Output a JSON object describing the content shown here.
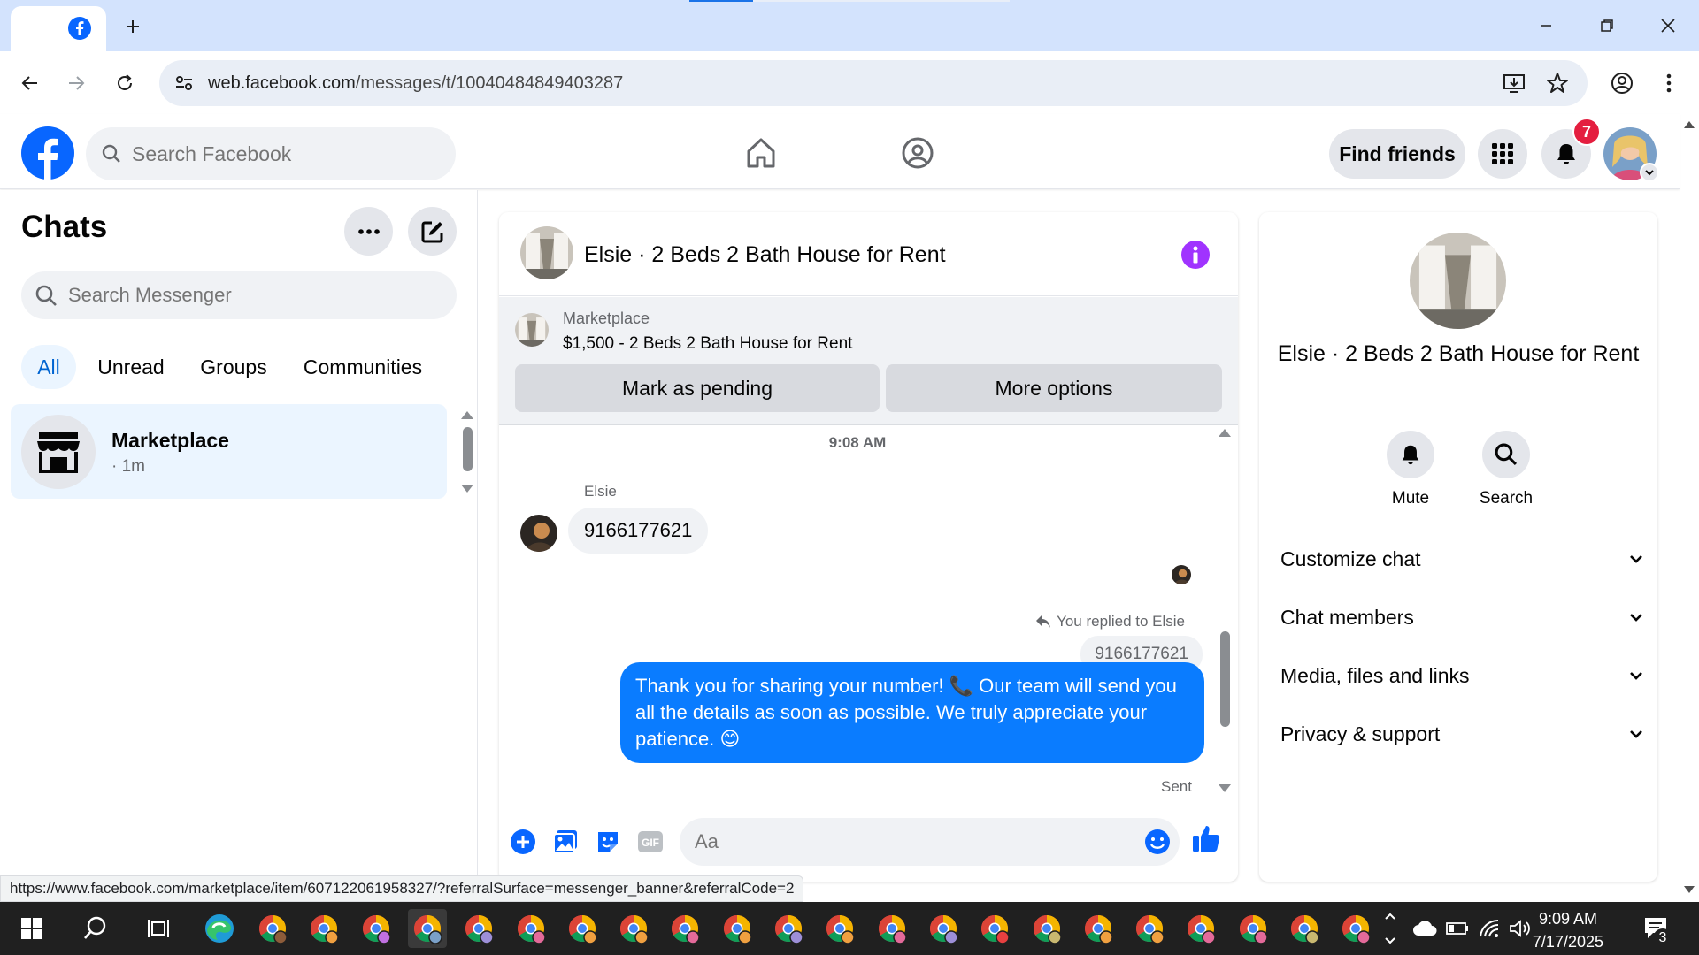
{
  "browser": {
    "url_domain": "web.facebook.com",
    "url_path": "/messages/t/10040484849403287"
  },
  "fb": {
    "search_placeholder": "Search Facebook",
    "find_friends_label": "Find friends",
    "notification_count": "7"
  },
  "chats": {
    "title": "Chats",
    "search_placeholder": "Search Messenger",
    "filters": [
      "All",
      "Unread",
      "Groups",
      "Communities"
    ],
    "active_filter": "All",
    "items": [
      {
        "name": "Marketplace",
        "time": "· 1m"
      }
    ]
  },
  "conversation": {
    "title": "Elsie · 2 Beds 2 Bath House for Rent",
    "banner": {
      "label": "Marketplace",
      "listing": "$1,500 - 2 Beds 2 Bath House for Rent",
      "primary_button": "Mark as pending",
      "secondary_button": "More options"
    },
    "timestamp": "9:08 AM",
    "sender_name": "Elsie",
    "incoming_message": "9166177621",
    "reply_note": "You replied to Elsie",
    "quoted_message": "9166177621",
    "outgoing_message": "Thank you for sharing your number! 📞 Our team will send you all the details as soon as possible. We truly appreciate your patience. 😊",
    "sent_status": "Sent",
    "composer_placeholder": "Aa"
  },
  "details": {
    "name": "Elsie · 2 Beds 2 Bath House for Rent",
    "actions": [
      {
        "label": "Mute",
        "icon": "bell-icon"
      },
      {
        "label": "Search",
        "icon": "search-icon"
      }
    ],
    "sections": [
      "Customize chat",
      "Chat members",
      "Media, files and links",
      "Privacy & support"
    ]
  },
  "status_link": "https://www.facebook.com/marketplace/item/607122061958327/?referralSurface=messenger_banner&referralCode=2",
  "taskbar": {
    "time": "9:09 AM",
    "date": "7/17/2025",
    "notification_count": "3"
  },
  "colors": {
    "fb_blue": "#0866ff",
    "messenger_blue": "#0a7cff",
    "badge_red": "#e41e3f",
    "info_purple": "#a033ff"
  }
}
